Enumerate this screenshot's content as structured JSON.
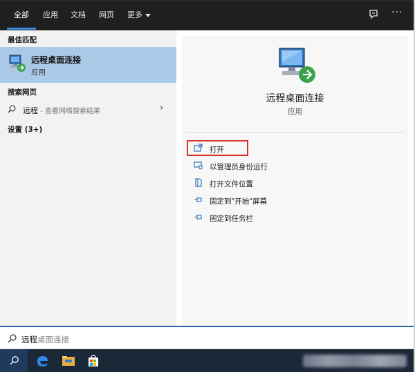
{
  "tabs": [
    {
      "label": "全部"
    },
    {
      "label": "应用"
    },
    {
      "label": "文档"
    },
    {
      "label": "网页"
    },
    {
      "label": "更多"
    }
  ],
  "left": {
    "best_match_header": "最佳匹配",
    "best_match": {
      "name": "远程桌面连接",
      "type": "应用"
    },
    "web_header": "搜索网页",
    "web_result": {
      "query": "远程",
      "suffix": " - 查看网络搜索结果"
    },
    "settings_header": "设置 (3+)"
  },
  "right": {
    "title": "远程桌面连接",
    "subtitle": "应用",
    "actions": [
      {
        "label": "打开",
        "icon": "open-window-icon"
      },
      {
        "label": "以管理员身份运行",
        "icon": "shield-run-icon"
      },
      {
        "label": "打开文件位置",
        "icon": "file-location-icon"
      },
      {
        "label": "固定到\"开始\"屏幕",
        "icon": "pin-icon"
      },
      {
        "label": "固定到任务栏",
        "icon": "pin-icon"
      }
    ]
  },
  "searchbox": {
    "typed": "远程",
    "hint": "桌面连接"
  },
  "colors": {
    "accent": "#3a8be0",
    "selected": "#aac9e6",
    "highlight_box": "#d9342b"
  }
}
